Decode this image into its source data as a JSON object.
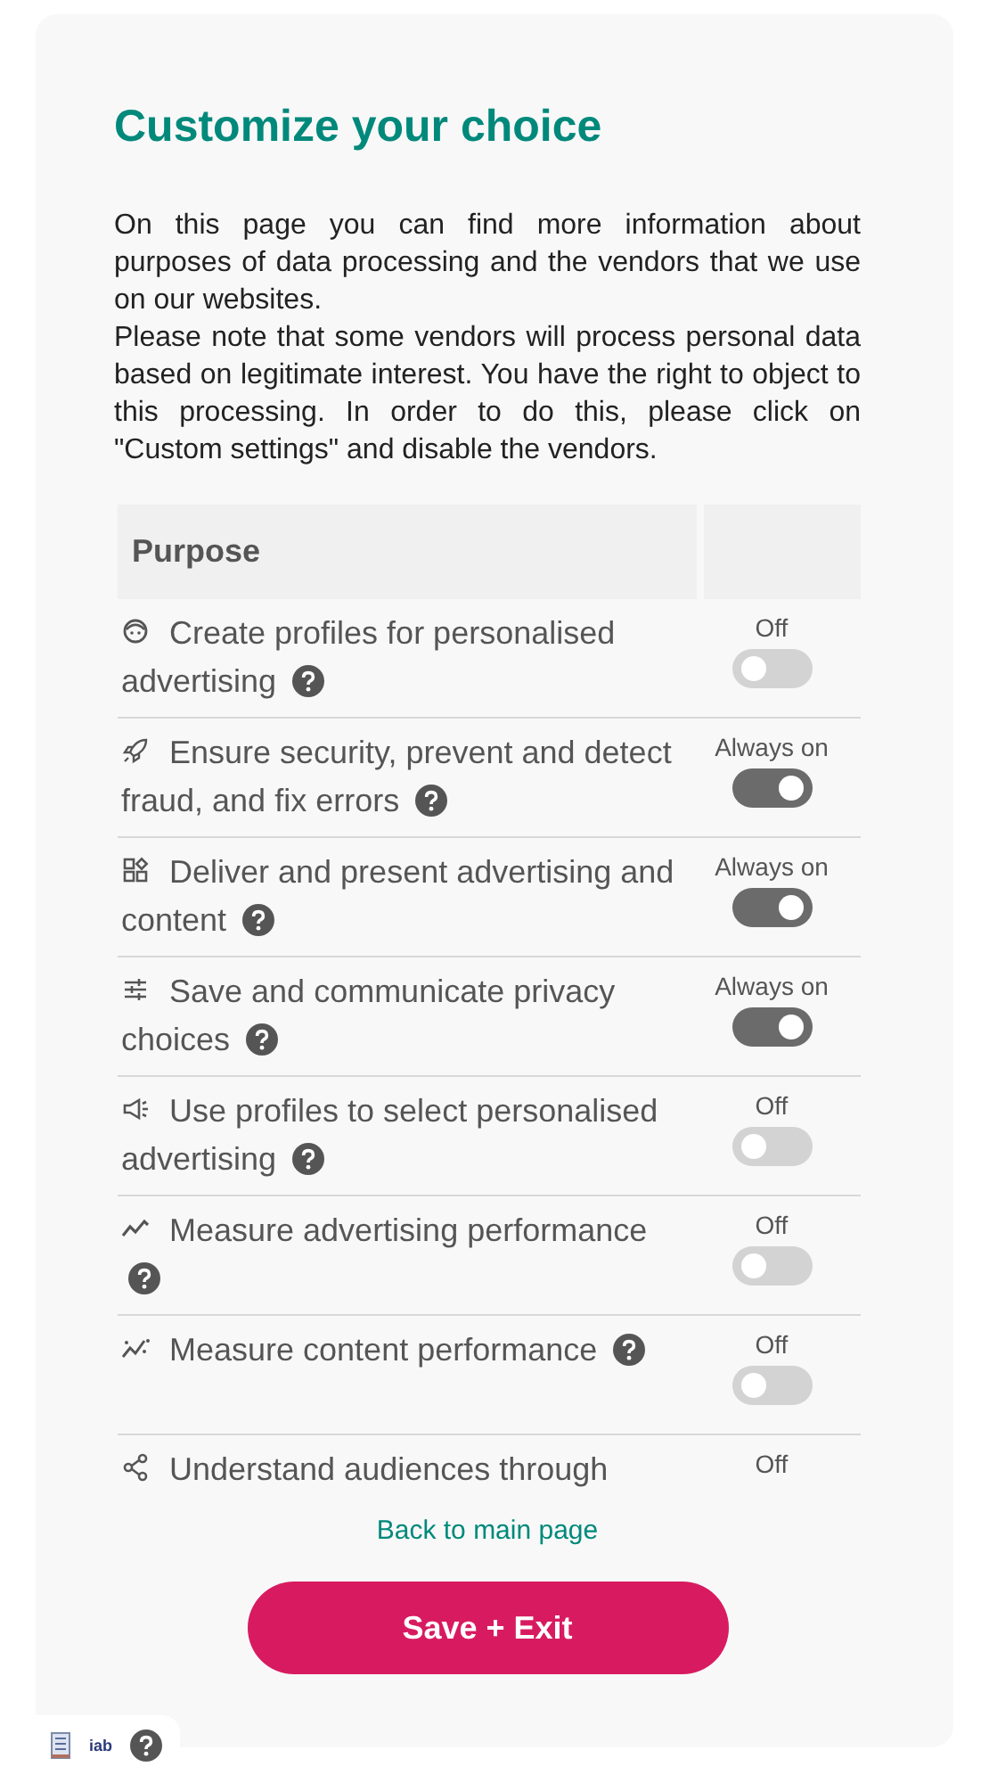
{
  "title": "Customize your choice",
  "intro": [
    "On this page you can find more information about purposes of data processing and the vendors that we use on our websites.",
    "Please note that some vendors will process personal data based on legitimate interest. You have the right to object to this processing. In order to do this, please click on \"Custom settings\" and disable the vendors."
  ],
  "table": {
    "columns": [
      "Purpose"
    ],
    "rows": [
      {
        "label": "Create profiles for personalised advertising",
        "status": "Off",
        "on": false
      },
      {
        "label": "Ensure security, prevent and detect fraud, and fix errors",
        "status": "Always on",
        "on": true
      },
      {
        "label": "Deliver and present advertising and content",
        "status": "Always on",
        "on": true
      },
      {
        "label": "Save and communicate privacy choices",
        "status": "Always on",
        "on": true
      },
      {
        "label": "Use profiles to select personalised advertising",
        "status": "Off",
        "on": false
      },
      {
        "label": "Measure advertising performance",
        "status": "Off",
        "on": false
      },
      {
        "label": "Measure content performance",
        "status": "Off",
        "on": false
      },
      {
        "label": "Understand audiences through",
        "status": "Off"
      }
    ]
  },
  "back_link": "Back to main page",
  "save_button": "Save + Exit",
  "footer": {
    "logo_text": "iab"
  }
}
